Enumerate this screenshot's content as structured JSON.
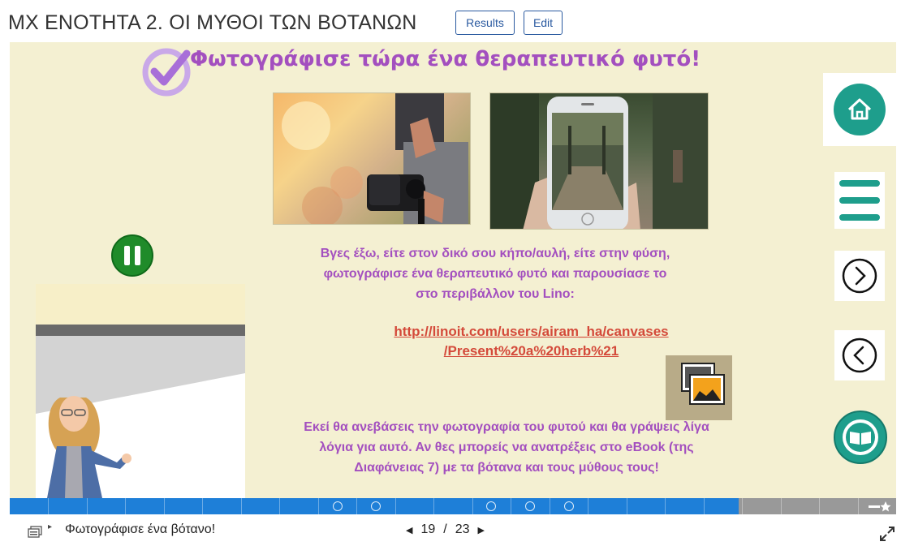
{
  "header": {
    "title": "ΜΧ ΕΝΟΤΗΤΑ 2. ΟΙ ΜΥΘΟΙ ΤΩΝ ΒΟΤΑΝΩΝ",
    "results_label": "Results",
    "edit_label": "Edit"
  },
  "slide": {
    "title": "Φωτογράφισε τώρα ένα θεραπευτικό φυτό!",
    "para1_line1": "Βγες έξω, είτε στον δικό σου κήπο/αυλή, είτε στην φύση,",
    "para1_line2": "φωτογράφισε ένα θεραπευτικό φυτό και παρουσίασε το",
    "para1_line3": "στο περιβάλλον του Lino:",
    "link_line1": "http://linoit.com/users/airam_ha/canvases",
    "link_line2": "/Present%20a%20herb%21",
    "para2_line1": "Εκεί θα ανεβάσεις την φωτογραφία του φυτού και θα γράψεις λίγα",
    "para2_line2": "λόγια για αυτό. Αν θες μπορείς να ανατρέξεις στο eBook (της",
    "para2_line3": "Διαφάνειας 7) με τα βότανα και τους μύθους τους!",
    "title_color": "#a34fbf",
    "text_color": "#a34fbf",
    "link_color": "#d44a3a",
    "background": "#f4f0d2"
  },
  "side_buttons": {
    "accent": "#1e9e8c",
    "icons": [
      "home-icon",
      "menu-icon",
      "next-arrow-icon",
      "previous-arrow-icon",
      "ebook-icon"
    ]
  },
  "progress": {
    "current": 19,
    "total": 23,
    "fill_color": "#1e7fd8"
  },
  "footer": {
    "chapter_label": "Φωτογράφισε ένα βότανο!",
    "page_current": "19",
    "page_sep": "/",
    "page_total": "23"
  }
}
